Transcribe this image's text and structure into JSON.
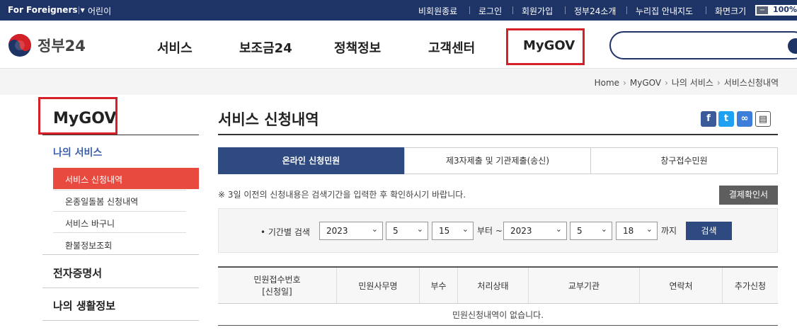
{
  "topbar": {
    "foreigners": "For Foreigners ▾",
    "kids": "어린이",
    "links": [
      "비회원종료",
      "로그인",
      "회원가입",
      "정부24소개",
      "누리집 안내지도",
      "화면크기"
    ],
    "zoom_minus": "−",
    "zoom_value": "100%"
  },
  "header": {
    "logo": "정부24",
    "nav": [
      "서비스",
      "보조금24",
      "정책정보",
      "고객센터",
      "MyGOV"
    ]
  },
  "breadcrumb": [
    "Home",
    "MyGOV",
    "나의 서비스",
    "서비스신청내역"
  ],
  "sidebar": {
    "title": "MyGOV",
    "group": "나의 서비스",
    "items": [
      "서비스 신청내역",
      "온종일돌봄 신청내역",
      "서비스 바구니",
      "환불정보조회"
    ],
    "heads": [
      "전자증명서",
      "나의 생활정보"
    ]
  },
  "main": {
    "title": "서비스 신청내역",
    "share": {
      "facebook": "f",
      "twitter": "t",
      "link": "∞",
      "print": "▤"
    },
    "tabs": [
      "온라인 신청민원",
      "제3자제출 및 기관제출(송신)",
      "창구접수민원"
    ],
    "notice": "※ 3일 이전의 신청내용은 검색기간을 입력한 후 확인하시기 바랍니다.",
    "pay_button": "결제확인서",
    "search": {
      "label": "• 기간별 검색",
      "from_year": "2023",
      "from_month": "5",
      "from_day": "15",
      "from_suffix": "부터 ~",
      "to_year": "2023",
      "to_month": "5",
      "to_day": "18",
      "to_suffix": "까지",
      "button": "검색"
    },
    "table": {
      "headers": [
        "민원접수번호",
        "[신청일]",
        "민원사무명",
        "부수",
        "처리상태",
        "교부기관",
        "연락처",
        "추가신청"
      ],
      "empty": "민원신청내역이 없습니다."
    }
  },
  "colors": {
    "navy": "#1f3466",
    "accent_red": "#d42027",
    "active_tab": "#2e4a80",
    "side_active": "#e84a3f"
  }
}
